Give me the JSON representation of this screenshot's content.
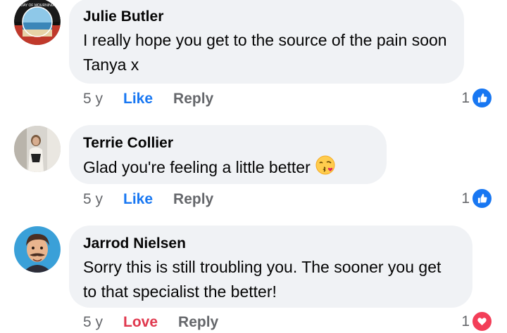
{
  "comments": [
    {
      "author": "Julie Butler",
      "text": "I really hope you get to the source of the pain soon Tanya x",
      "time": "5 y",
      "reaction_label": "Like",
      "reply_label": "Reply",
      "reaction_count": "1",
      "reaction_type": "like",
      "avatar_text": "DAY OF MOURNING"
    },
    {
      "author": "Terrie Collier",
      "text": "Glad you're feeling a little better",
      "emoji": "kissing-face-with-heart",
      "time": "5 y",
      "reaction_label": "Like",
      "reply_label": "Reply",
      "reaction_count": "1",
      "reaction_type": "like"
    },
    {
      "author": "Jarrod Nielsen",
      "text": "Sorry this is still troubling you. The sooner you get to that specialist the better!",
      "time": "5 y",
      "reaction_label": "Love",
      "reply_label": "Reply",
      "reaction_count": "1",
      "reaction_type": "love"
    }
  ],
  "colors": {
    "bubble": "#f0f2f5",
    "like_blue": "#1877f2",
    "love_red": "#e0384e",
    "meta_gray": "#65676b"
  }
}
